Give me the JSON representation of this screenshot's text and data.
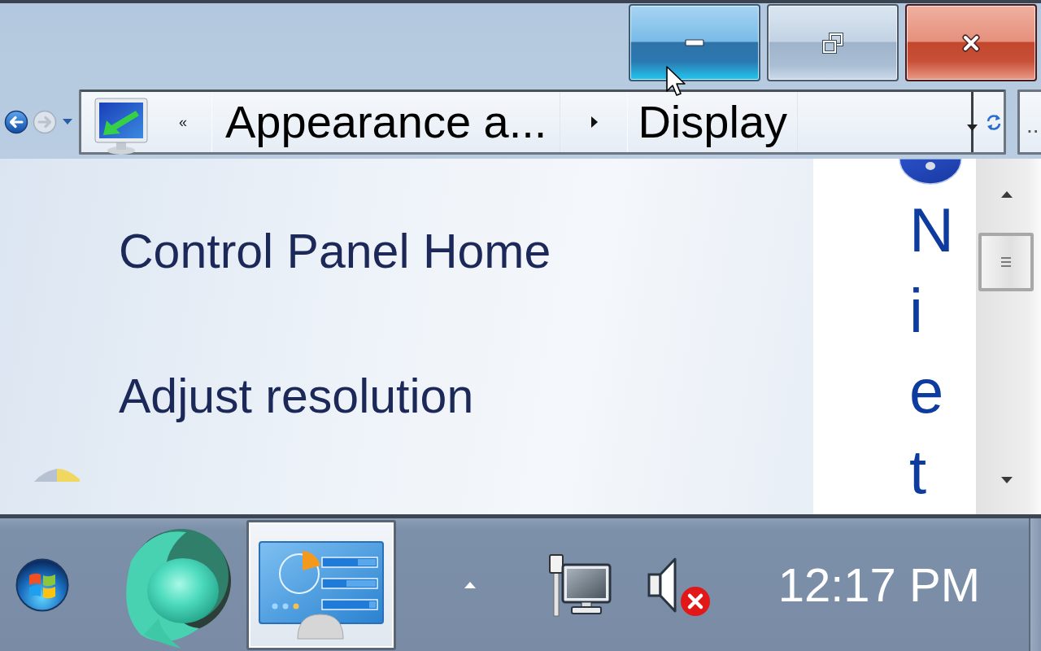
{
  "window": {
    "caption_buttons": [
      {
        "kind": "minimize",
        "hovered": true
      },
      {
        "kind": "restore",
        "hovered": false
      },
      {
        "kind": "close",
        "hovered": false
      }
    ]
  },
  "navigation": {
    "buttons": [
      {
        "kind": "back",
        "disabled": false
      },
      {
        "kind": "forward",
        "disabled": true
      }
    ]
  },
  "address_bar": {
    "overflow_chevron": "«",
    "crumbs": [
      {
        "label": "Appearance a..."
      },
      {
        "label": "Display"
      }
    ]
  },
  "search_field": {
    "placeholder": ".."
  },
  "left_pane": {
    "links": [
      {
        "label": "Control Panel Home"
      },
      {
        "label": "Adjust resolution"
      }
    ]
  },
  "right_pane": {
    "letters": [
      "N",
      "i",
      "e",
      "t"
    ]
  },
  "taskbar": {
    "buttons": [
      {
        "kind": "pinned",
        "active": false
      },
      {
        "kind": "window",
        "active": true
      }
    ],
    "tray": {
      "volume_muted": true
    },
    "clock": "12:17 PM"
  }
}
